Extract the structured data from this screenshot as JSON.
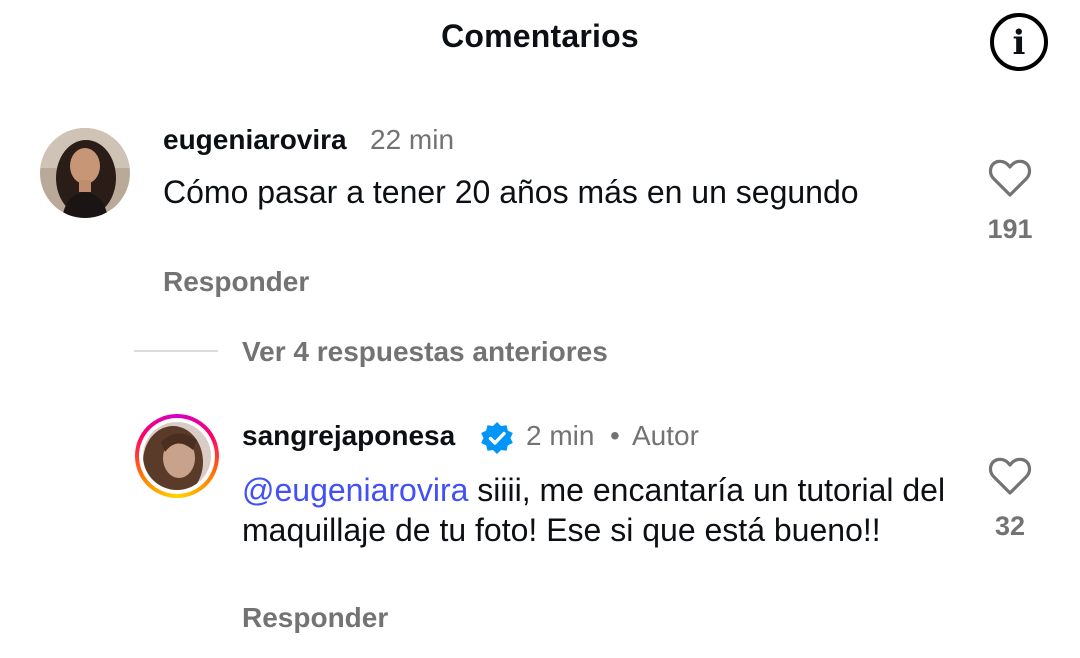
{
  "header": {
    "title": "Comentarios",
    "info_icon": "info-circle-icon"
  },
  "comments": [
    {
      "username": "eugeniarovira",
      "time": "22 min",
      "text": "Cómo pasar a tener 20 años más en un segundo",
      "reply_label": "Responder",
      "likes": "191",
      "like_icon": "heart-outline-icon"
    }
  ],
  "thread": {
    "view_replies_label": "Ver 4 respuestas anteriores"
  },
  "replies": [
    {
      "username": "sangrejaponesa",
      "verified": true,
      "time": "2 min",
      "separator": "•",
      "role": "Autor",
      "mention": "@eugeniarovira",
      "text": " siiii, me encantaría un tutorial del maquillaje de tu foto! Ese si que está bueno!!",
      "reply_label": "Responder",
      "likes": "32",
      "like_icon": "heart-outline-icon"
    }
  ],
  "colors": {
    "mention": "#4150f7",
    "muted": "#737373",
    "verified_badge": "#0095f6"
  }
}
